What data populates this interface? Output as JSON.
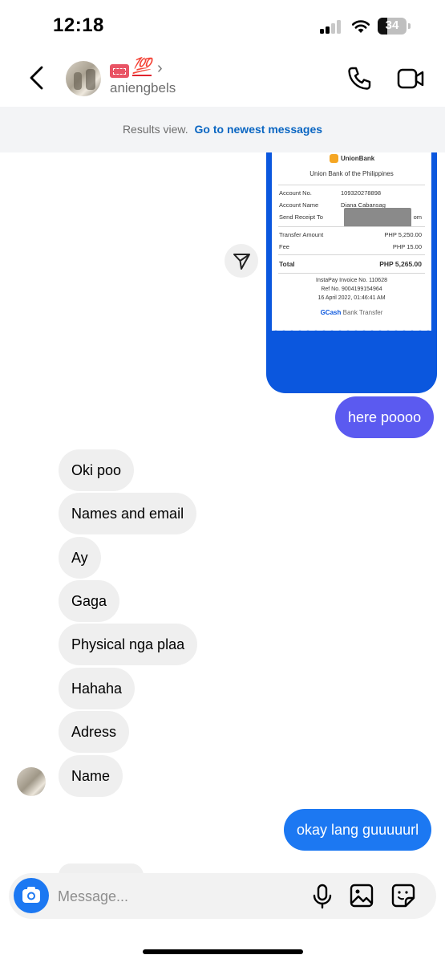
{
  "status_bar": {
    "time": "12:18",
    "battery": "34",
    "battery_level_percent": 34
  },
  "header": {
    "username": "aniengbels",
    "name_emojis": {
      "hundred": "💯"
    },
    "chevron": "›",
    "icons": [
      "back-chevron-icon",
      "phone-icon",
      "video-camera-icon"
    ]
  },
  "banner": {
    "text": "Results view.",
    "link": "Go to newest messages"
  },
  "receipt": {
    "bank_logo_text": "UnionBank",
    "bank_name": "Union Bank of the Philippines",
    "rows": [
      {
        "label": "Account No.",
        "value": "109320278898"
      },
      {
        "label": "Account Name",
        "value": "Diana Cabansag"
      },
      {
        "label": "Send Receipt To",
        "value": "om"
      }
    ],
    "amounts": [
      {
        "label": "Transfer Amount",
        "value": "PHP 5,250.00"
      },
      {
        "label": "Fee",
        "value": "PHP 15.00"
      }
    ],
    "total_label": "Total",
    "total_value": "PHP 5,265.00",
    "invoice": "InstaPay Invoice No. 110628",
    "ref": "Ref No. 9004199154964",
    "date": "16 April 2022, 01:46:41 AM",
    "footer_brand": "GCash",
    "footer_text": "Bank Transfer"
  },
  "messages": {
    "outgoing_1": "here poooo",
    "incoming": [
      "Oki poo",
      "Names and email",
      "Ay",
      "Gaga",
      "Physical nga plaa",
      "Hahaha",
      "Adress",
      "Name"
    ],
    "outgoing_2": "okay lang guuuuurl"
  },
  "composer": {
    "placeholder": "Message..."
  },
  "colors": {
    "outgoing_purple": "#5b5af0",
    "outgoing_blue": "#1c78f2",
    "link": "#0a66c2",
    "receipt_bg": "#0b57de"
  }
}
